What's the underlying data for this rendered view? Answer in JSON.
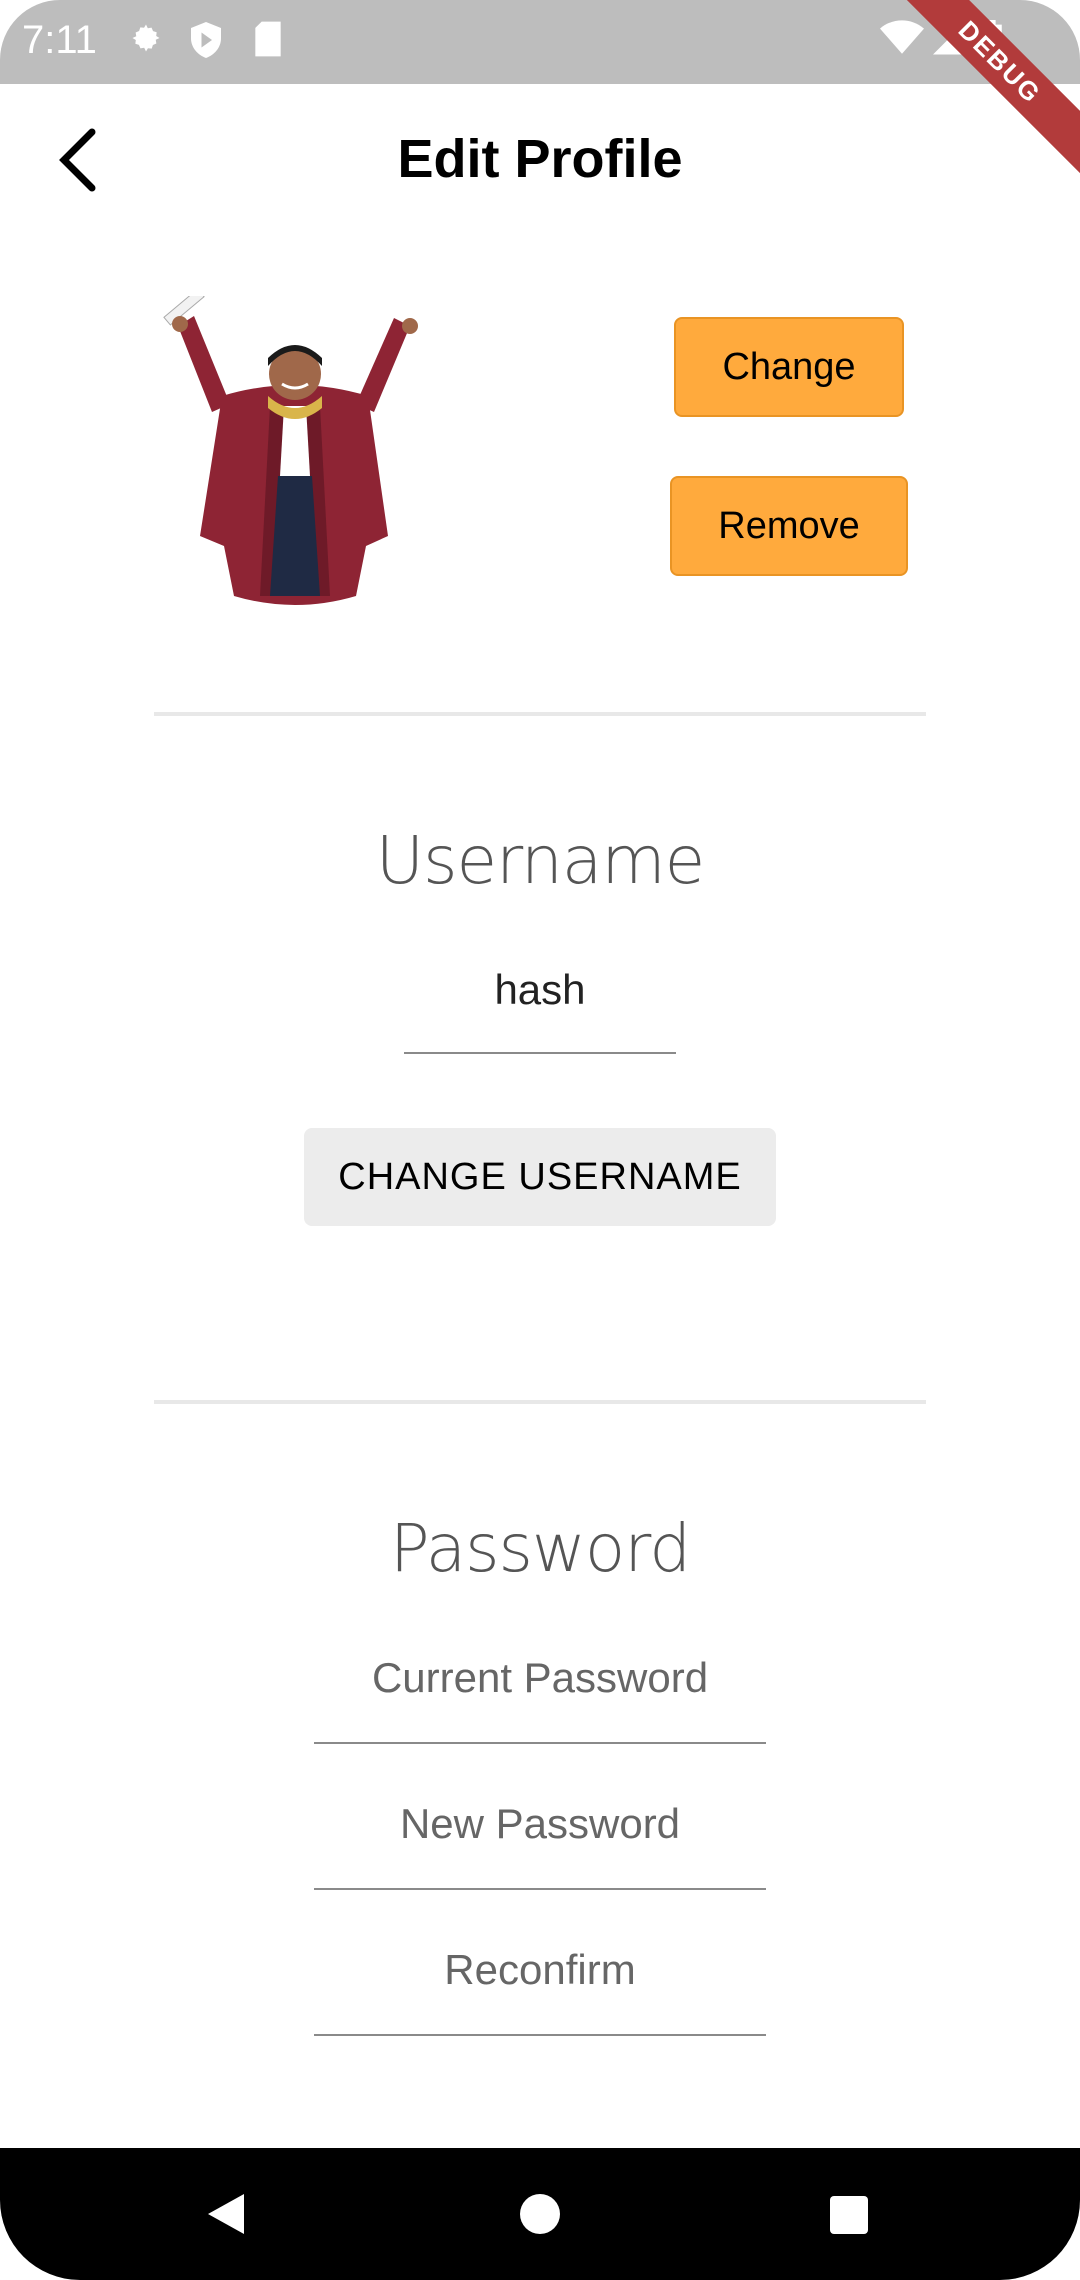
{
  "status_bar": {
    "time": "7:11",
    "icons": [
      "settings-icon",
      "shield-play-icon",
      "sd-card-icon",
      "wifi-icon",
      "cell-signal-icon",
      "battery-icon"
    ],
    "debug_banner": "DEBUG"
  },
  "header": {
    "title": "Edit Profile",
    "back_icon": "chevron-left-icon"
  },
  "avatar": {
    "change_label": "Change",
    "remove_label": "Remove"
  },
  "username_section": {
    "title": "Username",
    "value": "hash",
    "button_label": "CHANGE USERNAME"
  },
  "password_section": {
    "title": "Password",
    "current_placeholder": "Current Password",
    "new_placeholder": "New Password",
    "reconfirm_placeholder": "Reconfirm"
  },
  "nav_bar": {
    "icons": [
      "back-triangle-icon",
      "home-circle-icon",
      "recents-square-icon"
    ]
  },
  "colors": {
    "accent_button": "#ffaa3d",
    "status_bar": "#bdbdbd",
    "debug_ribbon": "#b23b3b"
  }
}
